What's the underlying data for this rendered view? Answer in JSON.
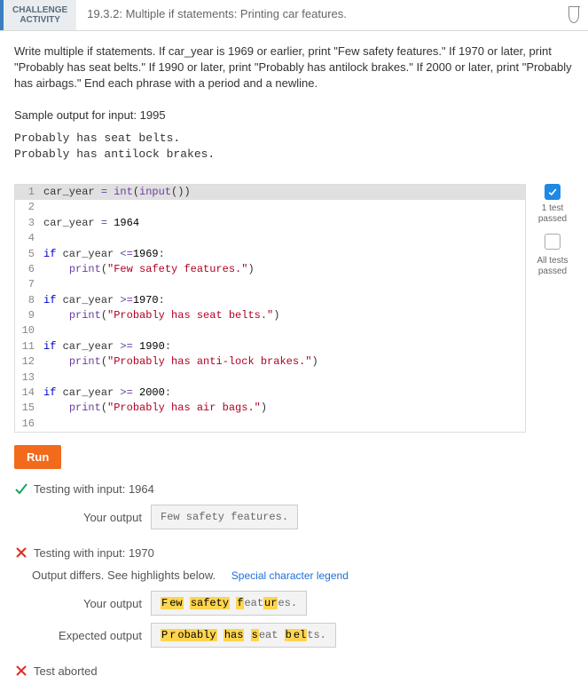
{
  "header": {
    "badge_line1": "CHALLENGE",
    "badge_line2": "ACTIVITY",
    "title": "19.3.2: Multiple if statements: Printing car features."
  },
  "instructions": "Write multiple if statements. If car_year is 1969 or earlier, print \"Few safety features.\" If 1970 or later, print \"Probably has seat belts.\" If 1990 or later, print \"Probably has antilock brakes.\" If 2000 or later, print \"Probably has airbags.\" End each phrase with a period and a newline.",
  "sample_label": "Sample output for input: 1995",
  "sample_output": "Probably has seat belts.\nProbably has antilock brakes.",
  "code": {
    "l1a": "car_year ",
    "l1b": "= ",
    "l1c": "int",
    "l1d": "(",
    "l1e": "input",
    "l1f": "())",
    "l3a": "car_year ",
    "l3b": "= ",
    "l3c": "1964",
    "l5a": "if",
    "l5b": " car_year ",
    "l5c": "<=",
    "l5d": "1969",
    "l5e": ":",
    "l6a": "    ",
    "l6b": "print",
    "l6c": "(",
    "l6d": "\"Few safety features.\"",
    "l6e": ")",
    "l8a": "if",
    "l8b": " car_year ",
    "l8c": ">=",
    "l8d": "1970",
    "l8e": ":",
    "l9a": "    ",
    "l9b": "print",
    "l9c": "(",
    "l9d": "\"Probably has seat belts.\"",
    "l9e": ")",
    "l11a": "if",
    "l11b": " car_year ",
    "l11c": ">= ",
    "l11d": "1990",
    "l11e": ":",
    "l12a": "    ",
    "l12b": "print",
    "l12c": "(",
    "l12d": "\"Probably has anti-lock brakes.\"",
    "l12e": ")",
    "l14a": "if",
    "l14b": " car_year ",
    "l14c": ">= ",
    "l14d": "2000",
    "l14e": ":",
    "l15a": "    ",
    "l15b": "print",
    "l15c": "(",
    "l15d": "\"Probably has air bags.\"",
    "l15e": ")"
  },
  "line_numbers": {
    "n1": "1",
    "n2": "2",
    "n3": "3",
    "n4": "4",
    "n5": "5",
    "n6": "6",
    "n7": "7",
    "n8": "8",
    "n9": "9",
    "n10": "10",
    "n11": "11",
    "n12": "12",
    "n13": "13",
    "n14": "14",
    "n15": "15",
    "n16": "16"
  },
  "side": {
    "passed_label": "1 test passed",
    "all_label": "All tests passed"
  },
  "run_label": "Run",
  "tests": {
    "t1_header": "Testing with input: 1964",
    "t1_your_label": "Your output",
    "t1_your_value": "Few safety features.",
    "t2_header": "Testing with input: 1970",
    "t2_diff_note": "Output differs. See highlights below.",
    "t2_legend": "Special character legend",
    "t2_your_label": "Your output",
    "t2_expected_label": "Expected output",
    "t2_your": {
      "p1": "F",
      "p2": "ew",
      " ": " ",
      "p3": "safety",
      " 2": " ",
      "p4": "f",
      "p5": "eat",
      "p6": "ur",
      "p7": "es."
    },
    "t2_expected": {
      "p1": "P",
      "p2": "r",
      "p3": "obably",
      " ": " ",
      "p4": "has",
      " 2": " ",
      "p5": "s",
      "p6": "eat",
      " 3": " ",
      "p7": "b",
      "p8": "el",
      "p9": "ts."
    },
    "aborted": "Test aborted"
  }
}
